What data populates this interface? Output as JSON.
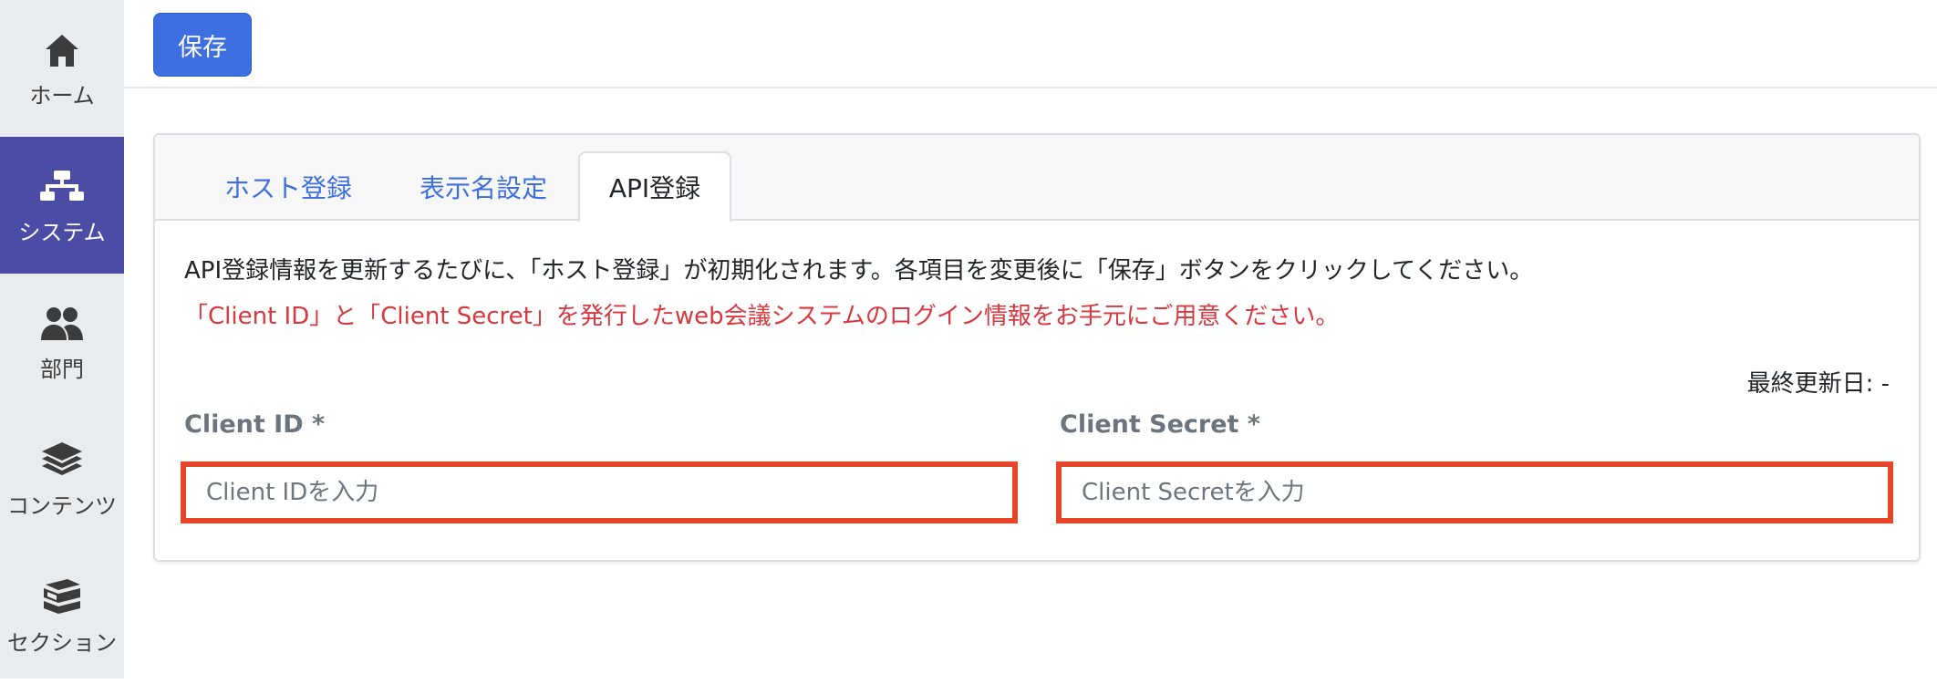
{
  "sidebar": {
    "items": [
      {
        "label": "ホーム",
        "icon": "home-icon",
        "active": false
      },
      {
        "label": "システム",
        "icon": "sitemap-icon",
        "active": true
      },
      {
        "label": "部門",
        "icon": "users-icon",
        "active": false
      },
      {
        "label": "コンテンツ",
        "icon": "layers-icon",
        "active": false
      },
      {
        "label": "セクション",
        "icon": "books-icon",
        "active": false
      }
    ]
  },
  "toolbar": {
    "save_label": "保存"
  },
  "tabs": [
    {
      "label": "ホスト登録",
      "active": false
    },
    {
      "label": "表示名設定",
      "active": false
    },
    {
      "label": "API登録",
      "active": true
    }
  ],
  "content": {
    "info_text": "API登録情報を更新するたびに、「ホスト登録」が初期化されます。各項目を変更後に「保存」ボタンをクリックしてください。",
    "note_text": "「Client ID」と「Client Secret」を発行したweb会議システムのログイン情報をお手元にご用意ください。",
    "last_updated": "最終更新日: -"
  },
  "form": {
    "client_id": {
      "label": "Client ID *",
      "placeholder": "Client IDを入力",
      "value": ""
    },
    "client_secret": {
      "label": "Client Secret *",
      "placeholder": "Client Secretを入力",
      "value": ""
    }
  },
  "colors": {
    "primary": "#3d6fe0",
    "sidebar_active": "#4a4ca6",
    "note_red": "#d9363e",
    "highlight_border": "#e8462a"
  }
}
